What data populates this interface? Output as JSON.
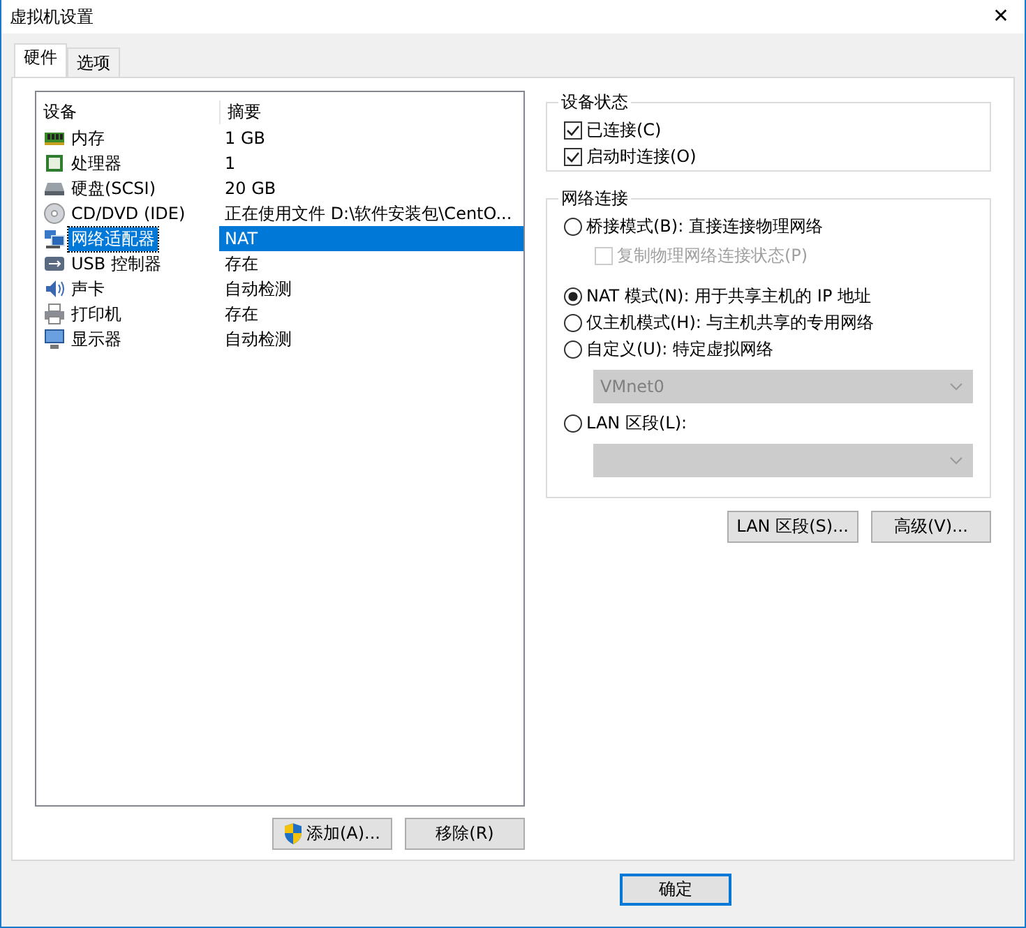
{
  "window": {
    "title": "虚拟机设置",
    "close": "✕"
  },
  "tabs": [
    {
      "label": "硬件",
      "selected": true
    },
    {
      "label": "选项",
      "selected": false
    }
  ],
  "device_table": {
    "columns": [
      "设备",
      "摘要"
    ],
    "rows": [
      {
        "kind": "memory",
        "device": "内存",
        "summary": "1 GB",
        "selected": false
      },
      {
        "kind": "cpu",
        "device": "处理器",
        "summary": "1",
        "selected": false
      },
      {
        "kind": "disk",
        "device": "硬盘(SCSI)",
        "summary": "20 GB",
        "selected": false
      },
      {
        "kind": "cdrom",
        "device": "CD/DVD (IDE)",
        "summary": "正在使用文件 D:\\软件安装包\\CentO...",
        "selected": false
      },
      {
        "kind": "network",
        "device": "网络适配器",
        "summary": "NAT",
        "selected": true
      },
      {
        "kind": "usb",
        "device": "USB 控制器",
        "summary": "存在",
        "selected": false
      },
      {
        "kind": "sound",
        "device": "声卡",
        "summary": "自动检测",
        "selected": false
      },
      {
        "kind": "printer",
        "device": "打印机",
        "summary": "存在",
        "selected": false
      },
      {
        "kind": "display",
        "device": "显示器",
        "summary": "自动检测",
        "selected": false
      }
    ]
  },
  "device_buttons": [
    "添加(A)...",
    "移除(R)"
  ],
  "device_status": {
    "title": "设备状态",
    "options": [
      {
        "label": "已连接(C)",
        "checked": true
      },
      {
        "label": "启动时连接(O)",
        "checked": true
      }
    ]
  },
  "network_connection": {
    "title": "网络连接",
    "items": [
      {
        "kind": "radio",
        "label": "桥接模式(B): 直接连接物理网络",
        "selected": false
      },
      {
        "kind": "checkbox",
        "label": "复制物理网络连接状态(P)",
        "checked": false,
        "disabled": true
      },
      {
        "kind": "radio",
        "label": "NAT 模式(N): 用于共享主机的 IP 地址",
        "selected": true
      },
      {
        "kind": "radio",
        "label": "仅主机模式(H): 与主机共享的专用网络",
        "selected": false
      },
      {
        "kind": "radio",
        "label": "自定义(U): 特定虚拟网络",
        "selected": false
      },
      {
        "kind": "dropdown",
        "value": "VMnet0",
        "disabled": true
      },
      {
        "kind": "radio",
        "label": "LAN 区段(L):",
        "selected": false
      },
      {
        "kind": "dropdown",
        "disabled": true
      }
    ]
  },
  "network_buttons": [
    "LAN 区段(S)...",
    "高级(V)..."
  ],
  "dialog_buttons": [
    "确定"
  ]
}
